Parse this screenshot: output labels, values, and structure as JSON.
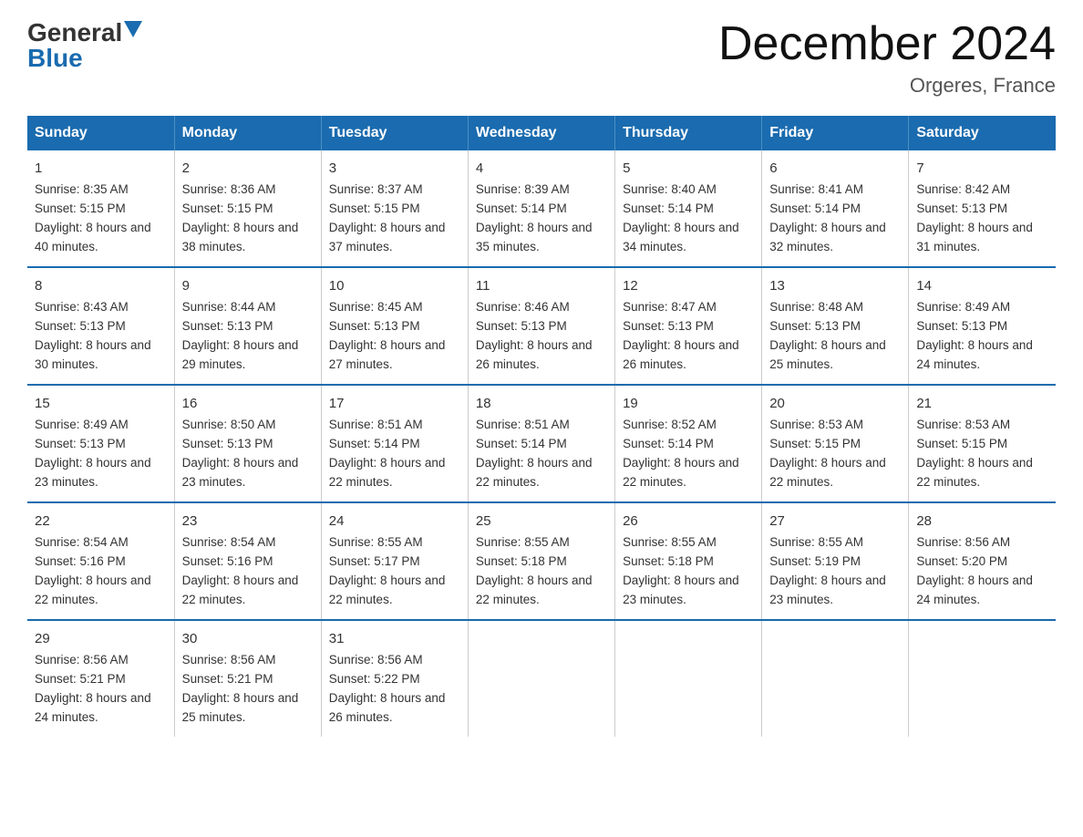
{
  "logo": {
    "general": "General",
    "arrow_symbol": "▲",
    "blue": "Blue"
  },
  "title": "December 2024",
  "subtitle": "Orgeres, France",
  "days_header": [
    "Sunday",
    "Monday",
    "Tuesday",
    "Wednesday",
    "Thursday",
    "Friday",
    "Saturday"
  ],
  "weeks": [
    [
      {
        "day": "1",
        "sunrise": "Sunrise: 8:35 AM",
        "sunset": "Sunset: 5:15 PM",
        "daylight": "Daylight: 8 hours and 40 minutes."
      },
      {
        "day": "2",
        "sunrise": "Sunrise: 8:36 AM",
        "sunset": "Sunset: 5:15 PM",
        "daylight": "Daylight: 8 hours and 38 minutes."
      },
      {
        "day": "3",
        "sunrise": "Sunrise: 8:37 AM",
        "sunset": "Sunset: 5:15 PM",
        "daylight": "Daylight: 8 hours and 37 minutes."
      },
      {
        "day": "4",
        "sunrise": "Sunrise: 8:39 AM",
        "sunset": "Sunset: 5:14 PM",
        "daylight": "Daylight: 8 hours and 35 minutes."
      },
      {
        "day": "5",
        "sunrise": "Sunrise: 8:40 AM",
        "sunset": "Sunset: 5:14 PM",
        "daylight": "Daylight: 8 hours and 34 minutes."
      },
      {
        "day": "6",
        "sunrise": "Sunrise: 8:41 AM",
        "sunset": "Sunset: 5:14 PM",
        "daylight": "Daylight: 8 hours and 32 minutes."
      },
      {
        "day": "7",
        "sunrise": "Sunrise: 8:42 AM",
        "sunset": "Sunset: 5:13 PM",
        "daylight": "Daylight: 8 hours and 31 minutes."
      }
    ],
    [
      {
        "day": "8",
        "sunrise": "Sunrise: 8:43 AM",
        "sunset": "Sunset: 5:13 PM",
        "daylight": "Daylight: 8 hours and 30 minutes."
      },
      {
        "day": "9",
        "sunrise": "Sunrise: 8:44 AM",
        "sunset": "Sunset: 5:13 PM",
        "daylight": "Daylight: 8 hours and 29 minutes."
      },
      {
        "day": "10",
        "sunrise": "Sunrise: 8:45 AM",
        "sunset": "Sunset: 5:13 PM",
        "daylight": "Daylight: 8 hours and 27 minutes."
      },
      {
        "day": "11",
        "sunrise": "Sunrise: 8:46 AM",
        "sunset": "Sunset: 5:13 PM",
        "daylight": "Daylight: 8 hours and 26 minutes."
      },
      {
        "day": "12",
        "sunrise": "Sunrise: 8:47 AM",
        "sunset": "Sunset: 5:13 PM",
        "daylight": "Daylight: 8 hours and 26 minutes."
      },
      {
        "day": "13",
        "sunrise": "Sunrise: 8:48 AM",
        "sunset": "Sunset: 5:13 PM",
        "daylight": "Daylight: 8 hours and 25 minutes."
      },
      {
        "day": "14",
        "sunrise": "Sunrise: 8:49 AM",
        "sunset": "Sunset: 5:13 PM",
        "daylight": "Daylight: 8 hours and 24 minutes."
      }
    ],
    [
      {
        "day": "15",
        "sunrise": "Sunrise: 8:49 AM",
        "sunset": "Sunset: 5:13 PM",
        "daylight": "Daylight: 8 hours and 23 minutes."
      },
      {
        "day": "16",
        "sunrise": "Sunrise: 8:50 AM",
        "sunset": "Sunset: 5:13 PM",
        "daylight": "Daylight: 8 hours and 23 minutes."
      },
      {
        "day": "17",
        "sunrise": "Sunrise: 8:51 AM",
        "sunset": "Sunset: 5:14 PM",
        "daylight": "Daylight: 8 hours and 22 minutes."
      },
      {
        "day": "18",
        "sunrise": "Sunrise: 8:51 AM",
        "sunset": "Sunset: 5:14 PM",
        "daylight": "Daylight: 8 hours and 22 minutes."
      },
      {
        "day": "19",
        "sunrise": "Sunrise: 8:52 AM",
        "sunset": "Sunset: 5:14 PM",
        "daylight": "Daylight: 8 hours and 22 minutes."
      },
      {
        "day": "20",
        "sunrise": "Sunrise: 8:53 AM",
        "sunset": "Sunset: 5:15 PM",
        "daylight": "Daylight: 8 hours and 22 minutes."
      },
      {
        "day": "21",
        "sunrise": "Sunrise: 8:53 AM",
        "sunset": "Sunset: 5:15 PM",
        "daylight": "Daylight: 8 hours and 22 minutes."
      }
    ],
    [
      {
        "day": "22",
        "sunrise": "Sunrise: 8:54 AM",
        "sunset": "Sunset: 5:16 PM",
        "daylight": "Daylight: 8 hours and 22 minutes."
      },
      {
        "day": "23",
        "sunrise": "Sunrise: 8:54 AM",
        "sunset": "Sunset: 5:16 PM",
        "daylight": "Daylight: 8 hours and 22 minutes."
      },
      {
        "day": "24",
        "sunrise": "Sunrise: 8:55 AM",
        "sunset": "Sunset: 5:17 PM",
        "daylight": "Daylight: 8 hours and 22 minutes."
      },
      {
        "day": "25",
        "sunrise": "Sunrise: 8:55 AM",
        "sunset": "Sunset: 5:18 PM",
        "daylight": "Daylight: 8 hours and 22 minutes."
      },
      {
        "day": "26",
        "sunrise": "Sunrise: 8:55 AM",
        "sunset": "Sunset: 5:18 PM",
        "daylight": "Daylight: 8 hours and 23 minutes."
      },
      {
        "day": "27",
        "sunrise": "Sunrise: 8:55 AM",
        "sunset": "Sunset: 5:19 PM",
        "daylight": "Daylight: 8 hours and 23 minutes."
      },
      {
        "day": "28",
        "sunrise": "Sunrise: 8:56 AM",
        "sunset": "Sunset: 5:20 PM",
        "daylight": "Daylight: 8 hours and 24 minutes."
      }
    ],
    [
      {
        "day": "29",
        "sunrise": "Sunrise: 8:56 AM",
        "sunset": "Sunset: 5:21 PM",
        "daylight": "Daylight: 8 hours and 24 minutes."
      },
      {
        "day": "30",
        "sunrise": "Sunrise: 8:56 AM",
        "sunset": "Sunset: 5:21 PM",
        "daylight": "Daylight: 8 hours and 25 minutes."
      },
      {
        "day": "31",
        "sunrise": "Sunrise: 8:56 AM",
        "sunset": "Sunset: 5:22 PM",
        "daylight": "Daylight: 8 hours and 26 minutes."
      },
      null,
      null,
      null,
      null
    ]
  ]
}
